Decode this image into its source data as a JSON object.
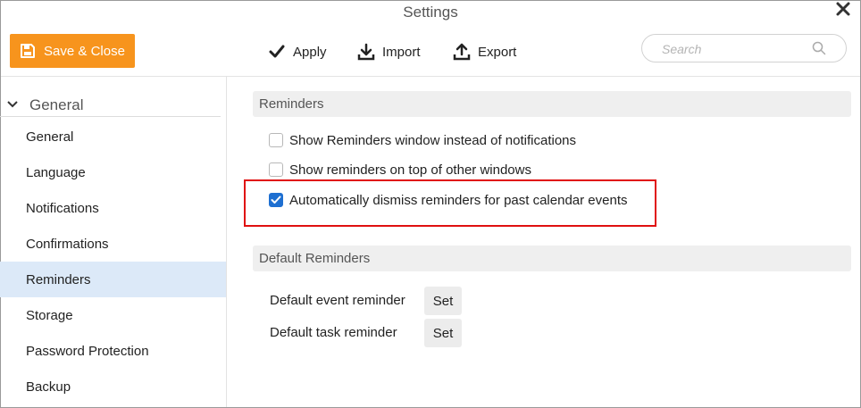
{
  "window": {
    "title": "Settings",
    "close_icon": "close-icon"
  },
  "toolbar": {
    "save_label": "Save & Close",
    "apply_label": "Apply",
    "import_label": "Import",
    "export_label": "Export",
    "search_placeholder": "Search",
    "search_value": "",
    "accent": "#f7941d"
  },
  "sidebar": {
    "group_label": "General",
    "items": [
      {
        "label": "General"
      },
      {
        "label": "Language"
      },
      {
        "label": "Notifications"
      },
      {
        "label": "Confirmations"
      },
      {
        "label": "Reminders",
        "active": true
      },
      {
        "label": "Storage"
      },
      {
        "label": "Password Protection"
      },
      {
        "label": "Backup"
      }
    ],
    "active_color": "#dce9f8"
  },
  "reminders": {
    "section_title": "Reminders",
    "options": [
      {
        "label": "Show Reminders window instead of notifications",
        "checked": false
      },
      {
        "label": "Show reminders on top of other windows",
        "checked": false
      },
      {
        "label": "Automatically dismiss reminders for past calendar events",
        "checked": true
      }
    ],
    "highlight_color": "#e01010"
  },
  "default_reminders": {
    "section_title": "Default Reminders",
    "rows": [
      {
        "label": "Default event reminder",
        "button": "Set"
      },
      {
        "label": "Default task reminder",
        "button": "Set"
      }
    ]
  }
}
